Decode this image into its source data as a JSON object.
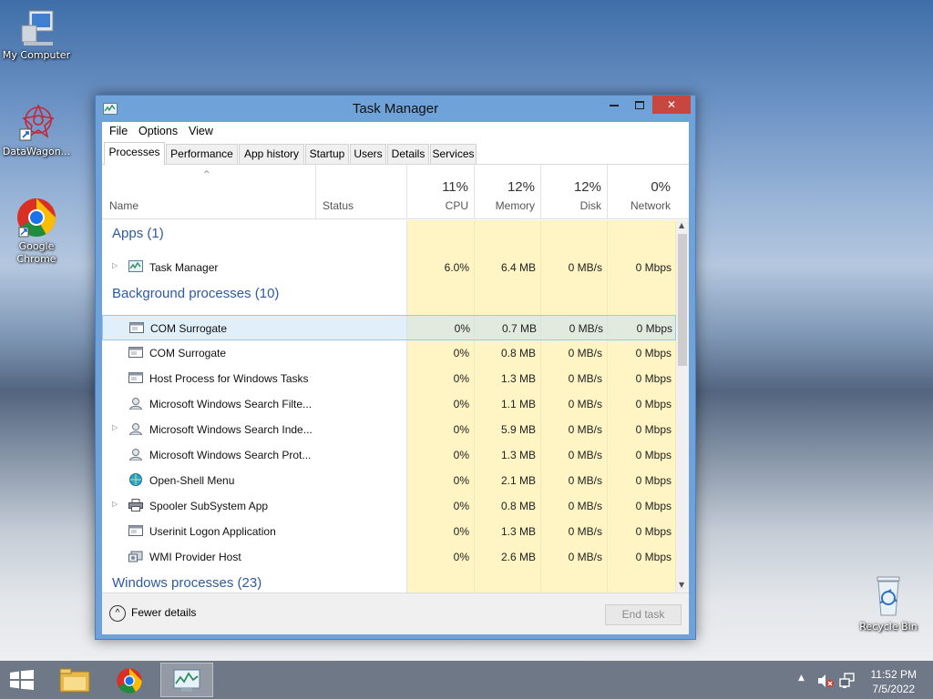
{
  "desktop": {
    "icons": [
      {
        "label": "My Computer"
      },
      {
        "label": "DataWagon..."
      },
      {
        "label": "Google Chrome"
      },
      {
        "label": "Recycle Bin"
      }
    ]
  },
  "window": {
    "title": "Task Manager",
    "menu": [
      "File",
      "Options",
      "View"
    ],
    "tabs": [
      "Processes",
      "Performance",
      "App history",
      "Startup",
      "Users",
      "Details",
      "Services"
    ],
    "active_tab": "Processes",
    "columns": {
      "name": "Name",
      "status": "Status",
      "cpu": {
        "pct": "11%",
        "label": "CPU"
      },
      "memory": {
        "pct": "12%",
        "label": "Memory"
      },
      "disk": {
        "pct": "12%",
        "label": "Disk"
      },
      "network": {
        "pct": "0%",
        "label": "Network"
      }
    },
    "groups": {
      "apps": "Apps (1)",
      "background": "Background processes (10)",
      "windows": "Windows processes (23)"
    },
    "apps": [
      {
        "name": "Task Manager",
        "cpu": "6.0%",
        "memory": "6.4 MB",
        "disk": "0 MB/s",
        "network": "0 Mbps",
        "icon": "task-manager-icon",
        "expandable": true
      }
    ],
    "background": [
      {
        "name": "COM Surrogate",
        "cpu": "0%",
        "memory": "0.7 MB",
        "disk": "0 MB/s",
        "network": "0 Mbps",
        "icon": "process-window-icon",
        "expandable": false
      },
      {
        "name": "COM Surrogate",
        "cpu": "0%",
        "memory": "0.8 MB",
        "disk": "0 MB/s",
        "network": "0 Mbps",
        "icon": "process-window-icon",
        "expandable": false
      },
      {
        "name": "Host Process for Windows Tasks",
        "cpu": "0%",
        "memory": "1.3 MB",
        "disk": "0 MB/s",
        "network": "0 Mbps",
        "icon": "process-window-icon",
        "expandable": false
      },
      {
        "name": "Microsoft Windows Search Filte...",
        "cpu": "0%",
        "memory": "1.1 MB",
        "disk": "0 MB/s",
        "network": "0 Mbps",
        "icon": "search-user-icon",
        "expandable": false
      },
      {
        "name": "Microsoft Windows Search Inde...",
        "cpu": "0%",
        "memory": "5.9 MB",
        "disk": "0 MB/s",
        "network": "0 Mbps",
        "icon": "search-user-icon",
        "expandable": true
      },
      {
        "name": "Microsoft Windows Search Prot...",
        "cpu": "0%",
        "memory": "1.3 MB",
        "disk": "0 MB/s",
        "network": "0 Mbps",
        "icon": "search-user-icon",
        "expandable": false
      },
      {
        "name": "Open-Shell Menu",
        "cpu": "0%",
        "memory": "2.1 MB",
        "disk": "0 MB/s",
        "network": "0 Mbps",
        "icon": "shell-orb-icon",
        "expandable": false
      },
      {
        "name": "Spooler SubSystem App",
        "cpu": "0%",
        "memory": "0.8 MB",
        "disk": "0 MB/s",
        "network": "0 Mbps",
        "icon": "printer-icon",
        "expandable": true
      },
      {
        "name": "Userinit Logon Application",
        "cpu": "0%",
        "memory": "1.3 MB",
        "disk": "0 MB/s",
        "network": "0 Mbps",
        "icon": "process-window-icon",
        "expandable": false
      },
      {
        "name": "WMI Provider Host",
        "cpu": "0%",
        "memory": "2.6 MB",
        "disk": "0 MB/s",
        "network": "0 Mbps",
        "icon": "wmi-icon",
        "expandable": false
      }
    ],
    "footer": {
      "fewer_details": "Fewer details",
      "end_task": "End task"
    }
  },
  "taskbar": {
    "time": "11:52 PM",
    "date": "7/5/2022"
  }
}
